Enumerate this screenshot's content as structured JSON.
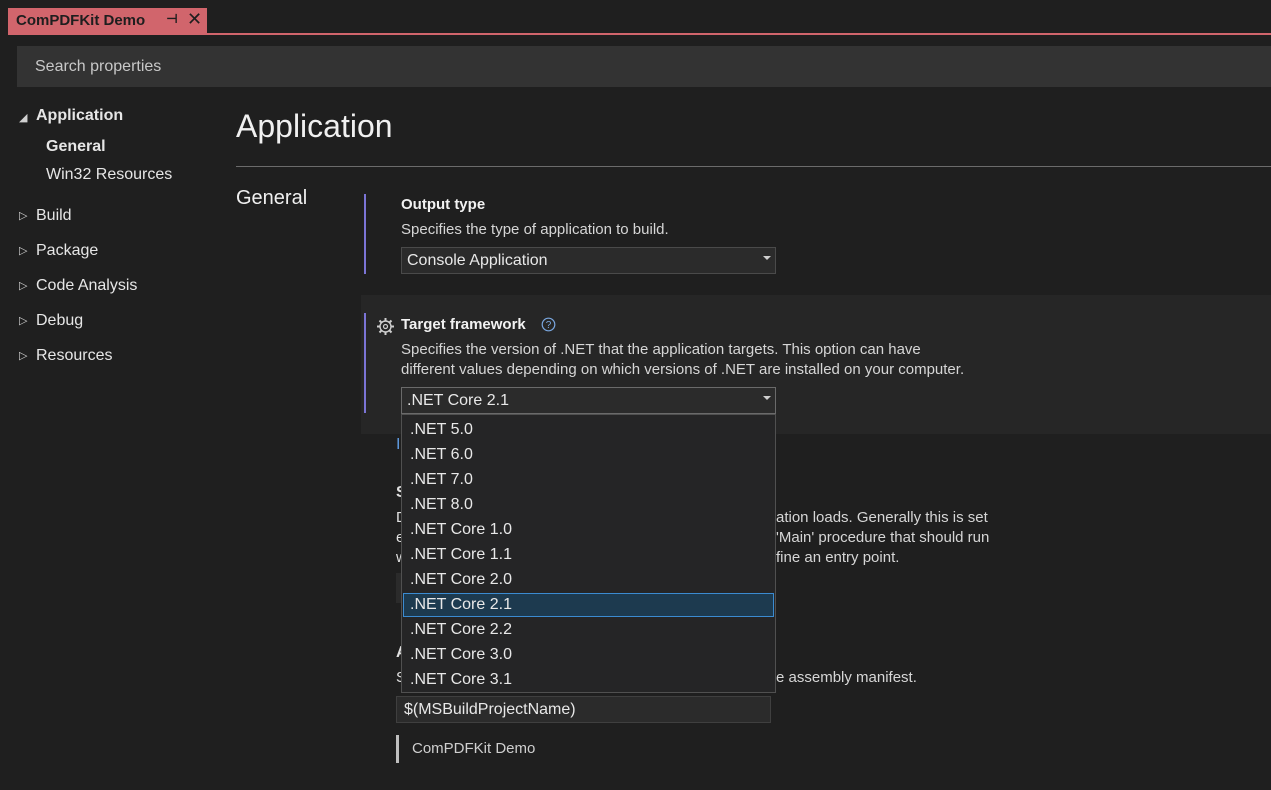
{
  "tab": {
    "title": "ComPDFKit Demo",
    "pin_icon": "pin-icon",
    "close_icon": "close-icon"
  },
  "search": {
    "placeholder": "Search properties"
  },
  "nav": {
    "application": "Application",
    "general": "General",
    "win32": "Win32 Resources",
    "build": "Build",
    "package": "Package",
    "code_analysis": "Code Analysis",
    "debug": "Debug",
    "resources": "Resources"
  },
  "main": {
    "page_title": "Application",
    "section_title": "General",
    "output_type": {
      "label": "Output type",
      "desc": "Specifies the type of application to build.",
      "value": "Console Application"
    },
    "target_framework": {
      "label": "Target framework",
      "desc_line1": "Specifies the version of .NET that the application targets. This option can have",
      "desc_line2": "different values depending on which versions of .NET are installed on your computer.",
      "value": ".NET Core 2.1",
      "options": [
        ".NET 5.0",
        ".NET 6.0",
        ".NET 7.0",
        ".NET 8.0",
        ".NET Core 1.0",
        ".NET Core 1.1",
        ".NET Core 2.0",
        ".NET Core 2.1",
        ".NET Core 2.2",
        ".NET Core 3.0",
        ".NET Core 3.1"
      ],
      "selected_index": 7
    },
    "hidden_fragments": {
      "link_char": "I",
      "startup_initial": "S",
      "desc_l1_initial": "D",
      "desc_l2_initial": "e",
      "desc_l3_initial": "w",
      "desc_l1_tail": "ation loads. Generally this is set",
      "desc_l2_tail": "'Main' procedure that should run",
      "desc_l3_tail": "fine an entry point.",
      "assembly_initial": "A",
      "assembly_desc_initial": "S",
      "assembly_desc_tail": "e assembly manifest."
    },
    "assembly_name_value": "$(MSBuildProjectName)",
    "assembly_name_preview": "ComPDFKit Demo"
  },
  "colors": {
    "accent": "#7b74d6",
    "tab": "#d1656c",
    "selection": "#1d3a4f"
  }
}
